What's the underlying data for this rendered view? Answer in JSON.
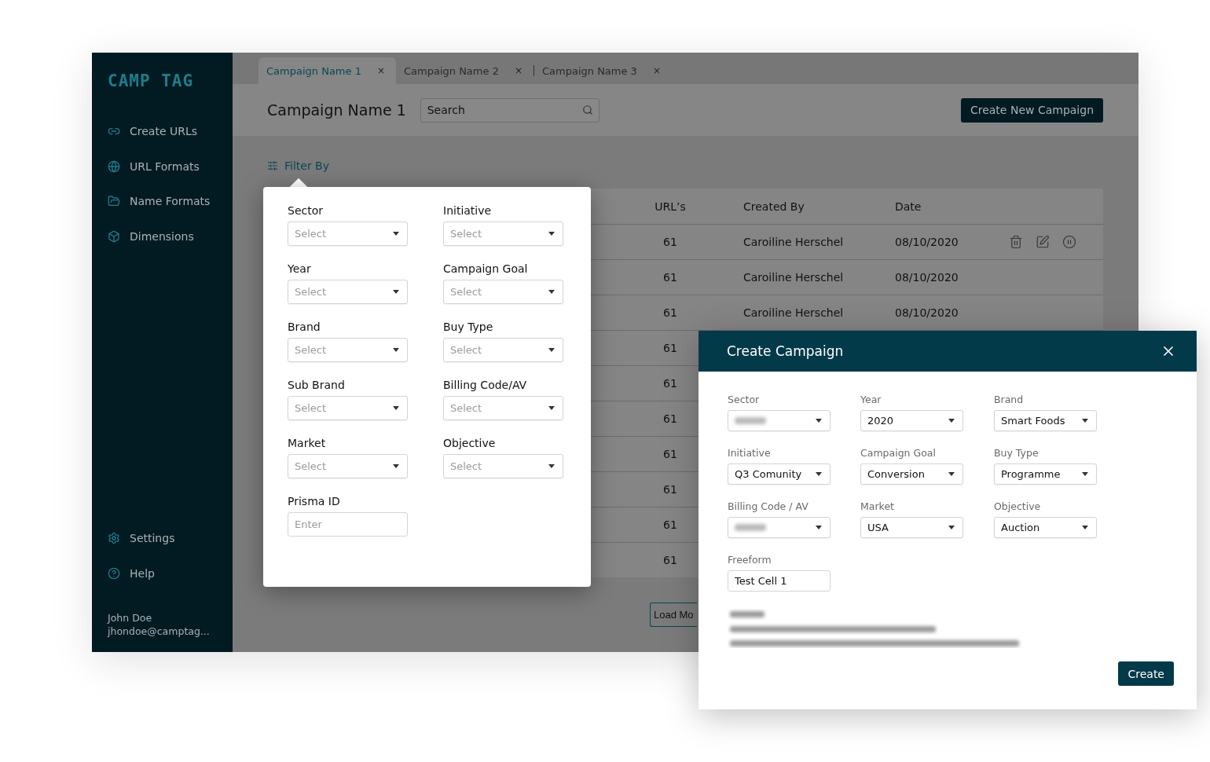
{
  "sidebar": {
    "logo": "CAMP TAG",
    "nav": [
      {
        "label": "Create URLs"
      },
      {
        "label": "URL Formats"
      },
      {
        "label": "Name Formats"
      },
      {
        "label": "Dimensions"
      }
    ],
    "bottom_nav": [
      {
        "label": "Settings"
      },
      {
        "label": "Help"
      }
    ],
    "user": {
      "name": "John Doe",
      "email": "jhondoe@camptag..."
    }
  },
  "tabs": [
    {
      "label": "Campaign Name 1",
      "close": "×",
      "selected": true
    },
    {
      "label": "Campaign Name 2",
      "close": "×",
      "selected": false
    },
    {
      "label": "Campaign Name 3",
      "close": "×",
      "selected": false
    }
  ],
  "header": {
    "title": "Campaign Name 1",
    "search": {
      "placeholder": "Search"
    },
    "create_button": "Create New Campaign"
  },
  "filter": {
    "label": "Filter By",
    "fields": [
      {
        "label": "Sector",
        "kind": "select",
        "placeholder": "Select"
      },
      {
        "label": "Initiative",
        "kind": "select",
        "placeholder": "Select"
      },
      {
        "label": "Year",
        "kind": "select",
        "placeholder": "Select"
      },
      {
        "label": "Campaign Goal",
        "kind": "select",
        "placeholder": "Select"
      },
      {
        "label": "Brand",
        "kind": "select",
        "placeholder": "Select"
      },
      {
        "label": "Buy Type",
        "kind": "select",
        "placeholder": "Select"
      },
      {
        "label": "Sub Brand",
        "kind": "select",
        "placeholder": "Select"
      },
      {
        "label": "Billing Code/AV",
        "kind": "select",
        "placeholder": "Select"
      },
      {
        "label": "Market",
        "kind": "select",
        "placeholder": "Select"
      },
      {
        "label": "Objective",
        "kind": "select",
        "placeholder": "Select"
      },
      {
        "label": "Prisma ID",
        "kind": "input",
        "placeholder": "Enter"
      }
    ]
  },
  "table": {
    "columns": [
      "URL’s",
      "Created By",
      "Date"
    ],
    "rows": [
      {
        "urls": "61",
        "created_by": "Caroiline Herschel",
        "date": "08/10/2020",
        "actions": true
      },
      {
        "urls": "61",
        "created_by": "Caroiline Herschel",
        "date": "08/10/2020",
        "actions": false
      },
      {
        "urls": "61",
        "created_by": "Caroiline Herschel",
        "date": "08/10/2020",
        "actions": false
      },
      {
        "urls": "61"
      },
      {
        "urls": "61"
      },
      {
        "urls": "61"
      },
      {
        "urls": "61"
      },
      {
        "urls": "61"
      },
      {
        "urls": "61"
      },
      {
        "urls": "61"
      }
    ]
  },
  "load_more": "Load Mo",
  "modal": {
    "title": "Create Campaign",
    "fields": [
      {
        "label": "Sector",
        "kind": "select",
        "blurred": true
      },
      {
        "label": "Year",
        "kind": "select",
        "value": "2020"
      },
      {
        "label": "Brand",
        "kind": "select",
        "value": "Smart Foods"
      },
      {
        "label": "Initiative",
        "kind": "select",
        "value": "Q3 Comunity"
      },
      {
        "label": "Campaign Goal",
        "kind": "select",
        "value": "Conversion"
      },
      {
        "label": "Buy Type",
        "kind": "select",
        "value": "Programme"
      },
      {
        "label": "Billing Code / AV",
        "kind": "select",
        "blurred": true
      },
      {
        "label": "Market",
        "kind": "select",
        "value": "USA"
      },
      {
        "label": "Objective",
        "kind": "select",
        "value": "Auction"
      },
      {
        "label": "Freeform",
        "kind": "input",
        "value": "Test Cell 1"
      }
    ],
    "preview_blurred": true,
    "create_button": "Create"
  }
}
